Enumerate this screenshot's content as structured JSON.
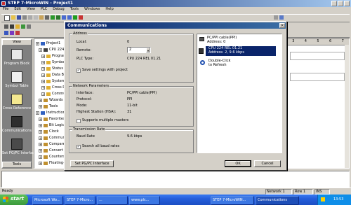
{
  "app": {
    "title": "STEP 7-MicroWIN - Project1",
    "menu": [
      "File",
      "Edit",
      "View",
      "PLC",
      "Debug",
      "Tools",
      "Windows",
      "Help"
    ]
  },
  "navbar": {
    "header": "View",
    "items": [
      {
        "label": "Program Block",
        "icon": "program-block-icon"
      },
      {
        "label": "Symbol Table",
        "icon": "symbol-table-icon"
      },
      {
        "label": "Cross Reference",
        "icon": "cross-reference-icon"
      },
      {
        "label": "Communications",
        "icon": "communications-icon"
      },
      {
        "label": "Set PG/PC Interface",
        "icon": "pgpc-interface-icon"
      }
    ],
    "footer": "Tools"
  },
  "tree": {
    "items": [
      "Project1",
      "CPU 224",
      "Program Block",
      "Symbol Table",
      "Status Chart",
      "Data Block",
      "System Block",
      "Cross Reference",
      "Communications",
      "Wizards",
      "Tools",
      "Instructions",
      "Favorites",
      "Bit Logic",
      "Clock",
      "Communications",
      "Compare",
      "Convert",
      "Counters",
      "Floating-Point"
    ]
  },
  "dialog": {
    "title": "Communications",
    "address": {
      "group_label": "Address",
      "local_label": "Local:",
      "local_value": "0",
      "remote_label": "Remote:",
      "remote_value": "2",
      "plc_type_label": "PLC Type:",
      "plc_type_value": "CPU 224 REL 01.21",
      "save_settings_label": "Save settings with project"
    },
    "network": {
      "group_label": "Network Parameters",
      "interface_label": "Interface:",
      "interface_value": "PC/PPI cable(PPI)",
      "protocol_label": "Protocol:",
      "protocol_value": "PPI",
      "mode_label": "Mode:",
      "mode_value": "11-bit",
      "hsa_label": "Highest Station (HSA):",
      "hsa_value": "31",
      "multimaster_label": "Supports multiple masters"
    },
    "transmission": {
      "group_label": "Transmission Rate",
      "baud_label": "Baud Rate",
      "baud_value": "9.6 kbps",
      "search_label": "Search all baud rates"
    },
    "right_tree": {
      "line1": "PC/PPI cable(PPI)",
      "line2": "Address: 0",
      "selected_line1": "CPU 224 REL 01.21",
      "selected_line2": "Address: 2, 9.6 kbps",
      "refresh_line1": "Double-Click",
      "refresh_line2": "to Refresh"
    },
    "buttons": {
      "set_interface": "Set PG/PC Interface",
      "ok": "OK",
      "cancel": "Cancel"
    }
  },
  "right_panel": {
    "ruler_numbers": [
      "3",
      "4",
      "5",
      "6",
      "7"
    ]
  },
  "status": {
    "ready": "Ready",
    "network_label": "Network 1",
    "row_label": "Row 1",
    "ins_label": "INS"
  },
  "taskbar": {
    "start_label": "start",
    "tasks": [
      "Microsoft Wo...",
      "STEP 7-Micro...",
      "...",
      "www.plc..."
    ],
    "tasks_right": [
      "STEP 7-MicroWIN...",
      "Communications"
    ],
    "clock": "13:53"
  },
  "colors": {
    "titlebar_start": "#0a246a",
    "titlebar_end": "#a6caf0",
    "dialog_titlebar_start": "#0a246a",
    "dialog_titlebar_end": "#3a6ea5",
    "selection": "#0a246a",
    "taskbar": "#245edb",
    "start_button": "#3c9a3c",
    "tray": "#0f8ee8"
  }
}
